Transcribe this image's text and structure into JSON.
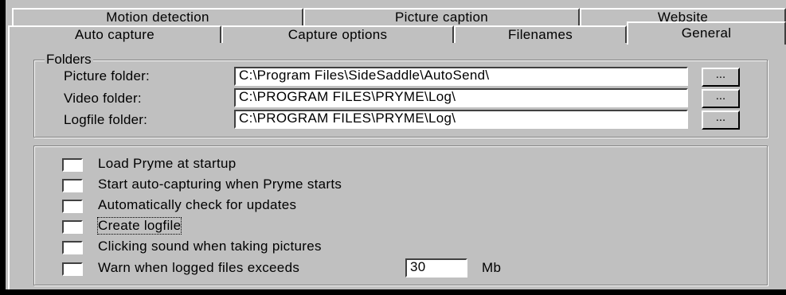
{
  "tabs": {
    "row_back": [
      "Motion detection",
      "Picture caption",
      "Website"
    ],
    "row_front": [
      "Auto capture",
      "Capture options",
      "Filenames",
      "General"
    ],
    "selected": "General"
  },
  "folders": {
    "group_title": "Folders",
    "picture_label": "Picture folder:",
    "picture_value": "C:\\Program Files\\SideSaddle\\AutoSend\\",
    "video_label": "Video folder:",
    "video_value": "C:\\PROGRAM FILES\\PRYME\\Log\\",
    "logfile_label": "Logfile folder:",
    "logfile_value": "C:\\PROGRAM FILES\\PRYME\\Log\\",
    "browse_label": "..."
  },
  "options": [
    {
      "label": "Load Pryme at startup",
      "checked": false
    },
    {
      "label": "Start auto-capturing when Pryme starts",
      "checked": false
    },
    {
      "label": "Automatically check for updates",
      "checked": false
    },
    {
      "label": "Create logfile",
      "checked": false
    },
    {
      "label": "Clicking sound when taking pictures",
      "checked": false
    },
    {
      "label": "Warn when logged files exceeds",
      "checked": false
    }
  ],
  "log_limit": {
    "value": "30",
    "unit": "Mb"
  }
}
